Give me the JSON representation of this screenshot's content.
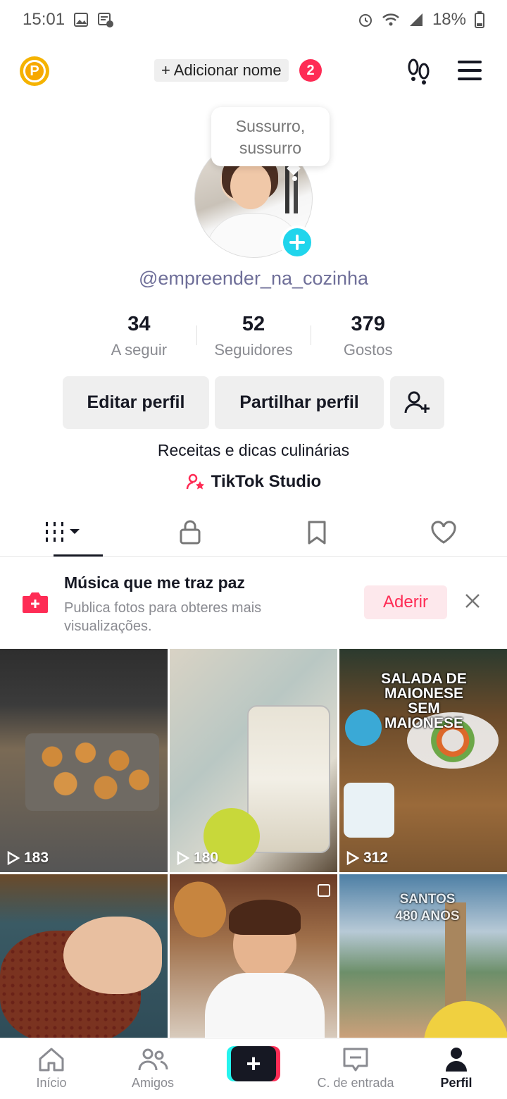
{
  "status_bar": {
    "time": "15:01",
    "battery": "18%"
  },
  "header": {
    "add_name_label": "+ Adicionar nome",
    "add_name_badge": "2"
  },
  "profile": {
    "bubble_text": "Sussurro, sussurro",
    "username": "@empreender_na_cozinha",
    "stats": [
      {
        "value": "34",
        "label": "A seguir"
      },
      {
        "value": "52",
        "label": "Seguidores"
      },
      {
        "value": "379",
        "label": "Gostos"
      }
    ],
    "buttons": {
      "edit": "Editar perfil",
      "share": "Partilhar perfil"
    },
    "bio": "Receitas e dicas culinárias",
    "studio_link": "TikTok Studio"
  },
  "tabs": [
    "videos-grid",
    "private",
    "saved",
    "liked"
  ],
  "banner": {
    "title": "Música que me traz paz",
    "subtitle": "Publica fotos para obteres mais visualizações.",
    "button": "Aderir"
  },
  "videos": [
    {
      "views": "183",
      "overlay": ""
    },
    {
      "views": "180",
      "overlay": ""
    },
    {
      "views": "312",
      "overlay": "SALADA DE MAIONESE SEM MAIONESE"
    },
    {
      "views": "",
      "overlay": ""
    },
    {
      "views": "",
      "overlay": ""
    },
    {
      "views": "",
      "overlay": "SANTOS 480 ANOS"
    }
  ],
  "bottom_nav": {
    "home": "Início",
    "friends": "Amigos",
    "inbox": "C. de entrada",
    "profile": "Perfil"
  },
  "colors": {
    "accent": "#fe2c55",
    "cyan": "#20d5ec",
    "coin": "#f5b301"
  }
}
